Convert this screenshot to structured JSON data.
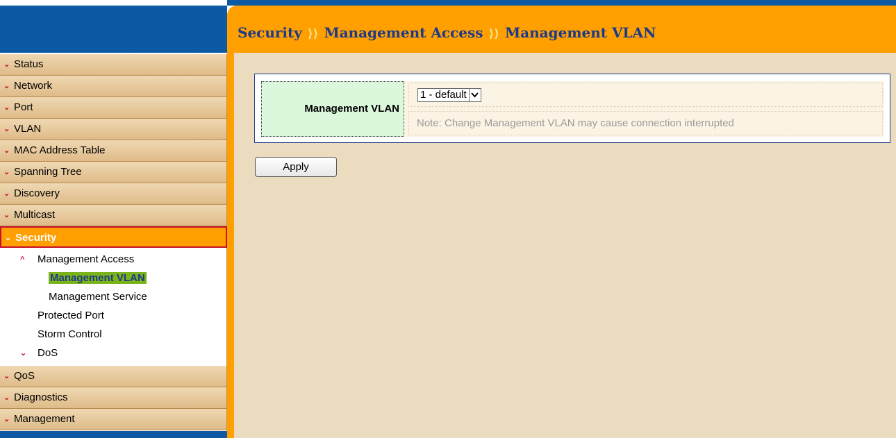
{
  "breadcrumb": {
    "items": [
      "Security",
      "Management Access",
      "Management VLAN"
    ],
    "separator": "⟩⟩"
  },
  "sidebar": {
    "items_before": [
      "Status",
      "Network",
      "Port",
      "VLAN",
      "MAC Address Table",
      "Spanning Tree",
      "Discovery",
      "Multicast"
    ],
    "active": "Security",
    "sub": {
      "management_access": "Management Access",
      "management_vlan": "Management VLAN",
      "management_service": "Management Service",
      "protected_port": "Protected Port",
      "storm_control": "Storm Control",
      "dos": "DoS"
    },
    "items_after": [
      "QoS",
      "Diagnostics",
      "Management"
    ]
  },
  "form": {
    "label": "Management VLAN",
    "selected_value": "1 - default",
    "note": "Note: Change Management VLAN may cause connection interrupted",
    "apply_label": "Apply"
  },
  "colors": {
    "blue": "#0d59a3",
    "orange": "#ff9f00",
    "breadcrumb_text": "#1c3a8a",
    "selected_highlight": "#7bb31a"
  }
}
